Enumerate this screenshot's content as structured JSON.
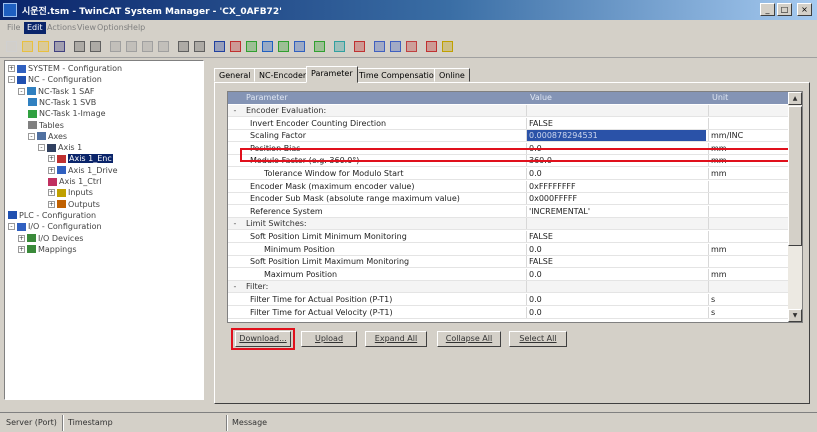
{
  "window": {
    "title": "시운전.tsm - TwinCAT System Manager - 'CX_0AFB72'"
  },
  "menu": {
    "items": [
      {
        "label": "File",
        "active": false
      },
      {
        "label": "Edit",
        "active": true
      },
      {
        "label": "Actions",
        "active": false
      },
      {
        "label": "View",
        "active": false
      },
      {
        "label": "Options",
        "active": false
      },
      {
        "label": "Help",
        "active": false
      }
    ]
  },
  "toolbar": {
    "icons": [
      "new-icon",
      "open-icon",
      "open-folder-icon",
      "save-icon",
      "print-icon",
      "preview-icon",
      "cut-icon",
      "copy-icon",
      "paste-icon",
      "paste-with-links-icon",
      "find-icon",
      "find-next-icon",
      "insert-icon",
      "delete-icon",
      "activate-config-icon",
      "check-icon",
      "set-run-mode-icon",
      "set-config-mode-icon",
      "show-online-icon",
      "network-icon",
      "choose-target-icon",
      "zoom-icon",
      "find-pointer-icon",
      "scope-icon",
      "ads-icon",
      "help-icon"
    ]
  },
  "tree": {
    "items": [
      {
        "label": "SYSTEM - Configuration",
        "icon": "system-icon",
        "expander": "+",
        "level": 0
      },
      {
        "label": "NC - Configuration",
        "icon": "nc-icon",
        "expander": "-",
        "level": 0
      },
      {
        "label": "NC-Task 1 SAF",
        "icon": "task-icon",
        "expander": "-",
        "level": 1
      },
      {
        "label": "NC-Task 1 SVB",
        "icon": "task-icon",
        "expander": "",
        "level": 2
      },
      {
        "label": "NC-Task 1-Image",
        "icon": "image-icon",
        "expander": "",
        "level": 2
      },
      {
        "label": "Tables",
        "icon": "table-icon",
        "expander": "",
        "level": 2
      },
      {
        "label": "Axes",
        "icon": "axes-icon",
        "expander": "-",
        "level": 2
      },
      {
        "label": "Axis 1",
        "icon": "axis-icon",
        "expander": "-",
        "level": 3
      },
      {
        "label": "Axis 1_Enc",
        "icon": "encoder-icon",
        "expander": "+",
        "level": 4,
        "selected": true
      },
      {
        "label": "Axis 1_Drive",
        "icon": "drive-icon",
        "expander": "+",
        "level": 4
      },
      {
        "label": "Axis 1_Ctrl",
        "icon": "controller-icon",
        "expander": "",
        "level": 4
      },
      {
        "label": "Inputs",
        "icon": "inputs-icon",
        "expander": "+",
        "level": 4
      },
      {
        "label": "Outputs",
        "icon": "outputs-icon",
        "expander": "+",
        "level": 4
      },
      {
        "label": "PLC - Configuration",
        "icon": "plc-icon",
        "expander": "",
        "level": 0
      },
      {
        "label": "I/O - Configuration",
        "icon": "io-icon",
        "expander": "-",
        "level": 0
      },
      {
        "label": "I/O Devices",
        "icon": "io-devices-icon",
        "expander": "+",
        "level": 1
      },
      {
        "label": "Mappings",
        "icon": "mappings-icon",
        "expander": "+",
        "level": 1
      }
    ]
  },
  "tabs": [
    {
      "label": "General",
      "active": false
    },
    {
      "label": "NC-Encoder",
      "active": false
    },
    {
      "label": "Parameter",
      "active": true
    },
    {
      "label": "Time Compensation",
      "active": false
    },
    {
      "label": "Online",
      "active": false
    }
  ],
  "grid": {
    "headers": {
      "name": "Parameter",
      "value": "Value",
      "unit": "Unit"
    },
    "rows": [
      {
        "type": "group",
        "expander": "-",
        "name": "Encoder Evaluation:",
        "value": "",
        "unit": ""
      },
      {
        "type": "row",
        "indent": 0,
        "name": "Invert Encoder Counting Direction",
        "value": "FALSE",
        "unit": ""
      },
      {
        "type": "row",
        "indent": 0,
        "name": "Scaling Factor",
        "value": "0.000878294531",
        "unit": "mm/INC",
        "selected": true
      },
      {
        "type": "row",
        "indent": 0,
        "name": "Position Bias",
        "value": "0.0",
        "unit": "mm"
      },
      {
        "type": "row",
        "indent": 0,
        "name": "Modulo Factor (e.g. 360.0°)",
        "value": "360.0",
        "unit": "mm"
      },
      {
        "type": "row",
        "indent": 1,
        "name": "Tolerance Window for Modulo Start",
        "value": "0.0",
        "unit": "mm"
      },
      {
        "type": "row",
        "indent": 0,
        "name": "Encoder Mask (maximum encoder value)",
        "value": "0xFFFFFFFF",
        "unit": ""
      },
      {
        "type": "row",
        "indent": 0,
        "name": "Encoder Sub Mask (absolute range maximum value)",
        "value": "0x000FFFFF",
        "unit": ""
      },
      {
        "type": "row",
        "indent": 0,
        "name": "Reference System",
        "value": "'INCREMENTAL'",
        "unit": ""
      },
      {
        "type": "group",
        "expander": "-",
        "name": "Limit Switches:",
        "value": "",
        "unit": ""
      },
      {
        "type": "row",
        "indent": 0,
        "name": "Soft Position Limit Minimum Monitoring",
        "value": "FALSE",
        "unit": ""
      },
      {
        "type": "row",
        "indent": 1,
        "name": "Minimum Position",
        "value": "0.0",
        "unit": "mm"
      },
      {
        "type": "row",
        "indent": 0,
        "name": "Soft Position Limit Maximum Monitoring",
        "value": "FALSE",
        "unit": ""
      },
      {
        "type": "row",
        "indent": 1,
        "name": "Maximum Position",
        "value": "0.0",
        "unit": "mm"
      },
      {
        "type": "group",
        "expander": "-",
        "name": "Filter:",
        "value": "",
        "unit": ""
      },
      {
        "type": "row",
        "indent": 0,
        "name": "Filter Time for Actual Position (P-T1)",
        "value": "0.0",
        "unit": "s"
      },
      {
        "type": "row",
        "indent": 0,
        "name": "Filter Time for Actual Velocity (P-T1)",
        "value": "0.0",
        "unit": "s"
      }
    ]
  },
  "buttons": {
    "download": "Download...",
    "upload": "Upload",
    "expand_all": "Expand All",
    "collapse_all": "Collapse All",
    "select_all": "Select All"
  },
  "status": {
    "server_port": "Server (Port)",
    "timestamp": "Timestamp",
    "message": "Message"
  },
  "colors": {
    "highlight": "#e0101c",
    "selection": "#0a246a",
    "grid_header": "#8494b5"
  }
}
